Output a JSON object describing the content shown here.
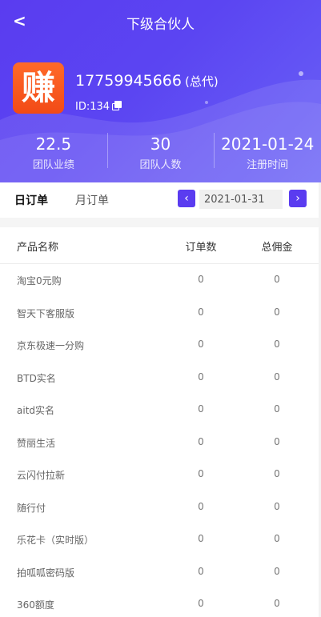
{
  "header": {
    "back_icon": "<",
    "title": "下级合伙人"
  },
  "profile": {
    "avatar_text": "赚",
    "phone": "17759945666",
    "role": "(总代)",
    "id_text": "ID:134"
  },
  "stats": [
    {
      "value": "22.5",
      "label": "团队业绩"
    },
    {
      "value": "30",
      "label": "团队人数"
    },
    {
      "value": "2021-01-24",
      "label": "注册时间"
    }
  ],
  "tabs": {
    "daily": "日订单",
    "monthly": "月订单"
  },
  "date_picker": {
    "prev": "‹",
    "value": "2021-01-31",
    "next": "›"
  },
  "table": {
    "headers": [
      "产品名称",
      "订单数",
      "总佣金"
    ],
    "rows": [
      {
        "name": "淘宝0元购",
        "orders": "0",
        "commission": "0"
      },
      {
        "name": "智天下客服版",
        "orders": "0",
        "commission": "0"
      },
      {
        "name": "京东极速一分购",
        "orders": "0",
        "commission": "0"
      },
      {
        "name": "BTD实名",
        "orders": "0",
        "commission": "0"
      },
      {
        "name": "aitd实名",
        "orders": "0",
        "commission": "0"
      },
      {
        "name": "赞丽生活",
        "orders": "0",
        "commission": "0"
      },
      {
        "name": "云闪付拉新",
        "orders": "0",
        "commission": "0"
      },
      {
        "name": "随行付",
        "orders": "0",
        "commission": "0"
      },
      {
        "name": "乐花卡（实时版）",
        "orders": "0",
        "commission": "0"
      },
      {
        "name": "拍呱呱密码版",
        "orders": "0",
        "commission": "0"
      },
      {
        "name": "360额度",
        "orders": "0",
        "commission": "0"
      }
    ]
  },
  "colors": {
    "accent": "#5a3cf0",
    "avatar": "#f24a16"
  }
}
